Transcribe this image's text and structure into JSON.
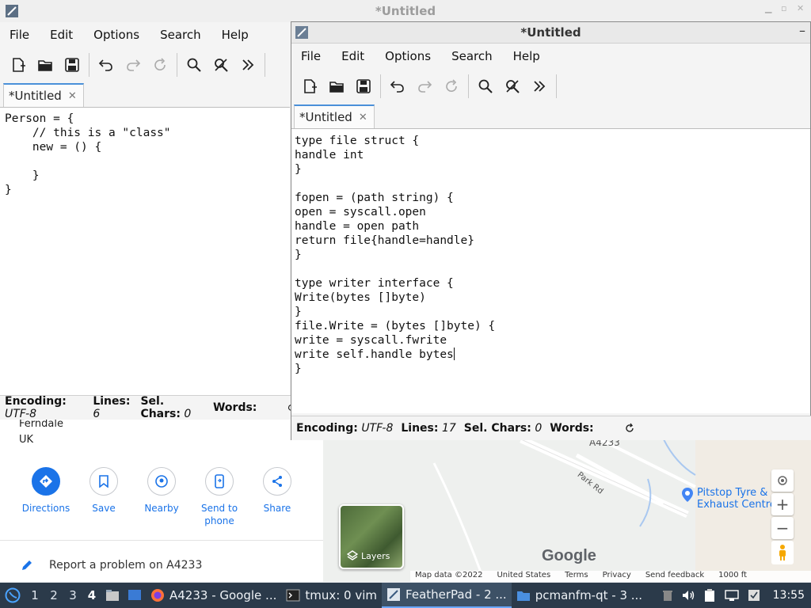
{
  "bg_window": {
    "title": "*Untitled"
  },
  "maps": {
    "address_lines": [
      "Ferndale",
      "UK"
    ],
    "actions": [
      {
        "label": "Directions",
        "icon": "directions-icon"
      },
      {
        "label": "Save",
        "icon": "bookmark-icon"
      },
      {
        "label": "Nearby",
        "icon": "nearby-icon"
      },
      {
        "label": "Send to phone",
        "icon": "phone-icon"
      },
      {
        "label": "Share",
        "icon": "share-icon"
      }
    ],
    "report_label": "Report a problem on A4233",
    "road_labels": [
      "A4233",
      "Park Rd"
    ],
    "poi": "Pitstop Tyre & Exhaust Centre",
    "layers_label": "Layers",
    "logo": "Google",
    "footer": [
      "Map data ©2022",
      "United States",
      "Terms",
      "Privacy",
      "Send feedback",
      "1000 ft"
    ]
  },
  "win1": {
    "menu": [
      "File",
      "Edit",
      "Options",
      "Search",
      "Help"
    ],
    "tab_title": "*Untitled",
    "lines": [
      "Person = {",
      "    // this is a \"class\"",
      "    new = () {",
      "",
      "    }",
      "}"
    ],
    "status": {
      "encoding_label": "Encoding:",
      "encoding": "UTF-8",
      "lines_label": "Lines:",
      "lines": "6",
      "sel_label": "Sel. Chars:",
      "sel": "0",
      "words_label": "Words:",
      "words": ""
    }
  },
  "win2": {
    "title": "*Untitled",
    "menu": [
      "File",
      "Edit",
      "Options",
      "Search",
      "Help"
    ],
    "tab_title": "*Untitled",
    "lines": [
      "type file struct {",
      "handle int",
      "}",
      "",
      "fopen = (path string) {",
      "open = syscall.open",
      "handle = open path",
      "return file{handle=handle}",
      "}",
      "",
      "type writer interface {",
      "Write(bytes []byte)",
      "}",
      "file.Write = (bytes []byte) {",
      "write = syscall.fwrite",
      "write self.handle bytes",
      "}"
    ],
    "status": {
      "encoding_label": "Encoding:",
      "encoding": "UTF-8",
      "lines_label": "Lines:",
      "lines": "17",
      "sel_label": "Sel. Chars:",
      "sel": "0",
      "words_label": "Words:",
      "words": ""
    }
  },
  "toolbar_icons": [
    "new-file-icon",
    "open-folder-icon",
    "save-icon",
    "undo-icon",
    "redo-icon",
    "reload-icon",
    "find-icon",
    "replace-icon",
    "more-icon"
  ],
  "taskbar": {
    "workspaces": [
      "1",
      "2",
      "3",
      "4"
    ],
    "active_workspace": "4",
    "tasks": [
      {
        "label": "A4233 - Google ...",
        "icon": "firefox-icon"
      },
      {
        "label": "tmux: 0 vim",
        "icon": "terminal-icon"
      },
      {
        "label": "FeatherPad - 2 ...",
        "icon": "featherpad-icon",
        "active": true
      },
      {
        "label": "pcmanfm-qt - 3 ...",
        "icon": "folder-icon"
      }
    ],
    "clock": "13:55"
  },
  "colors": {
    "accent": "#1a73e8",
    "taskbar": "#2b3a4a",
    "tab_indicator": "#4a90d9"
  }
}
